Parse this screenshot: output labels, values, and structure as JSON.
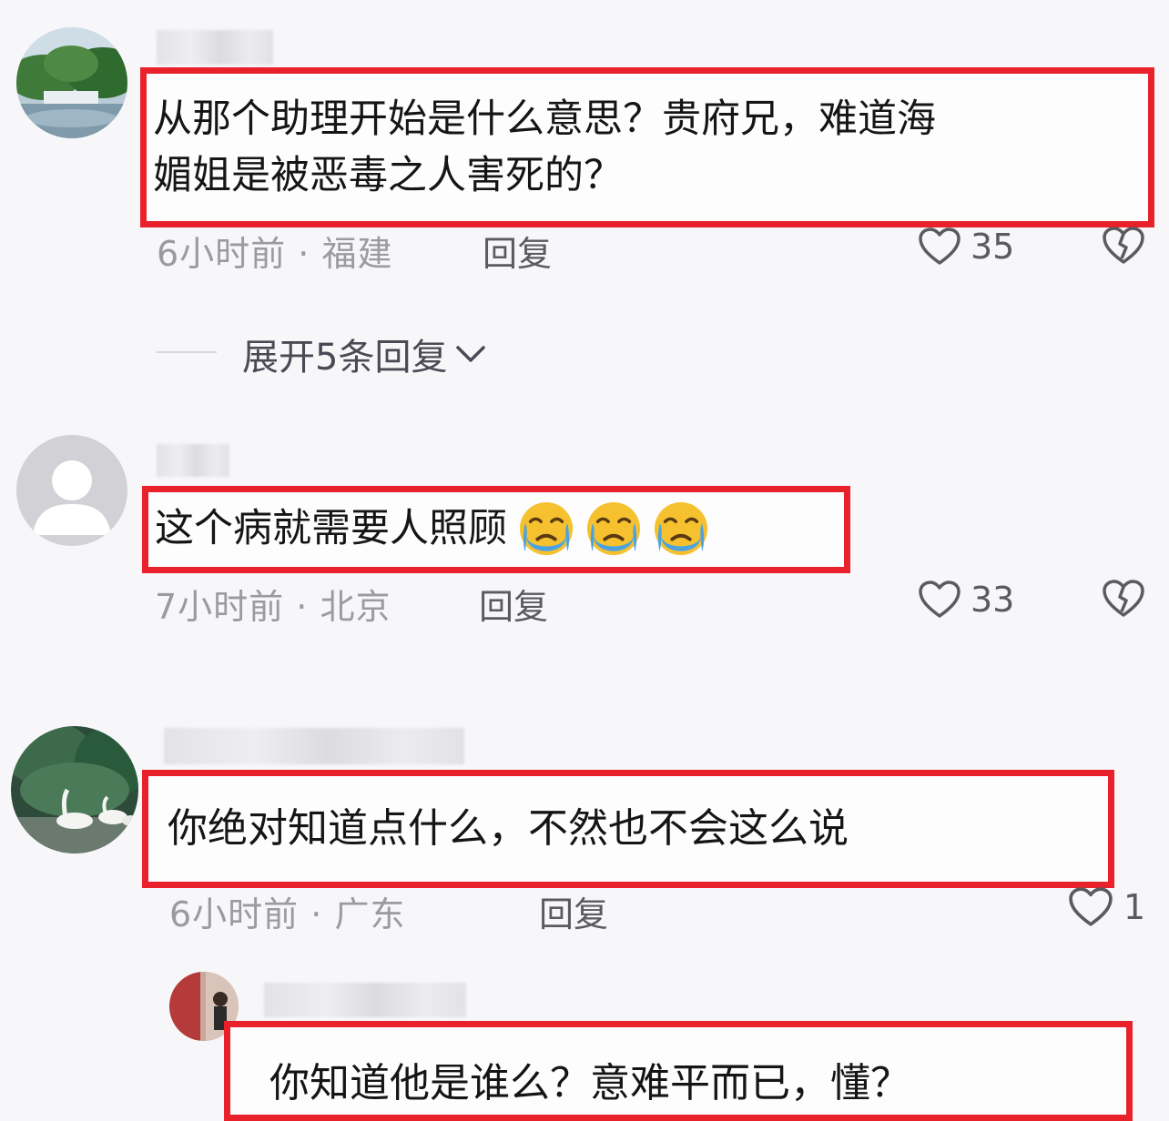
{
  "comments": [
    {
      "text_line1": "从那个助理开始是什么意思？贵府兄，难道海",
      "text_line2": "媚姐是被恶毒之人害死的？",
      "time": "6小时前",
      "location": "福建",
      "reply_label": "回复",
      "likes": "35"
    },
    {
      "text": "这个病就需要人照顾",
      "emoji": "loudly-crying-face",
      "time": "7小时前",
      "location": "北京",
      "reply_label": "回复",
      "likes": "33"
    },
    {
      "text": "你绝对知道点什么，不然也不会这么说",
      "time": "6小时前",
      "location": "广东",
      "reply_label": "回复",
      "likes": "1"
    }
  ],
  "expand_replies": {
    "label": "展开5条回复"
  },
  "nested_reply": {
    "text": "你知道他是谁么？意难平而已，懂？"
  },
  "colors": {
    "highlight_border": "#e8212a",
    "muted_text": "#9a9aa0"
  },
  "icons": [
    "heart-outline-icon",
    "broken-heart-icon",
    "chevron-down-icon",
    "default-avatar-icon"
  ]
}
